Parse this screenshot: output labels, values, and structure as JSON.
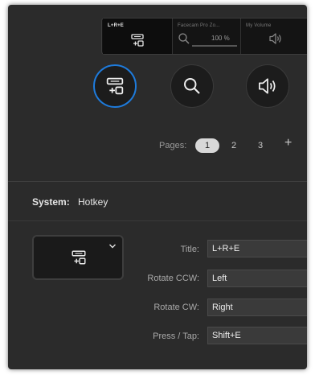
{
  "deck": {
    "key1_label": "L+R+E",
    "key2_label": "Facecam Pro Zo...",
    "key2_value": "100 %",
    "key3_label": "My Volume"
  },
  "pages": {
    "label": "Pages:",
    "items": [
      "1",
      "2",
      "3"
    ],
    "selected": "1",
    "add": "+"
  },
  "system": {
    "label": "System:",
    "value": "Hotkey"
  },
  "properties": {
    "title_label": "Title:",
    "title_value": "L+R+E",
    "rotate_ccw_label": "Rotate CCW:",
    "rotate_ccw_value": "Left",
    "rotate_cw_label": "Rotate CW:",
    "rotate_cw_value": "Right",
    "press_label": "Press / Tap:",
    "press_value": "Shift+E"
  },
  "colors": {
    "accent": "#1e7bdc",
    "window_bg": "#2b2b2b"
  }
}
